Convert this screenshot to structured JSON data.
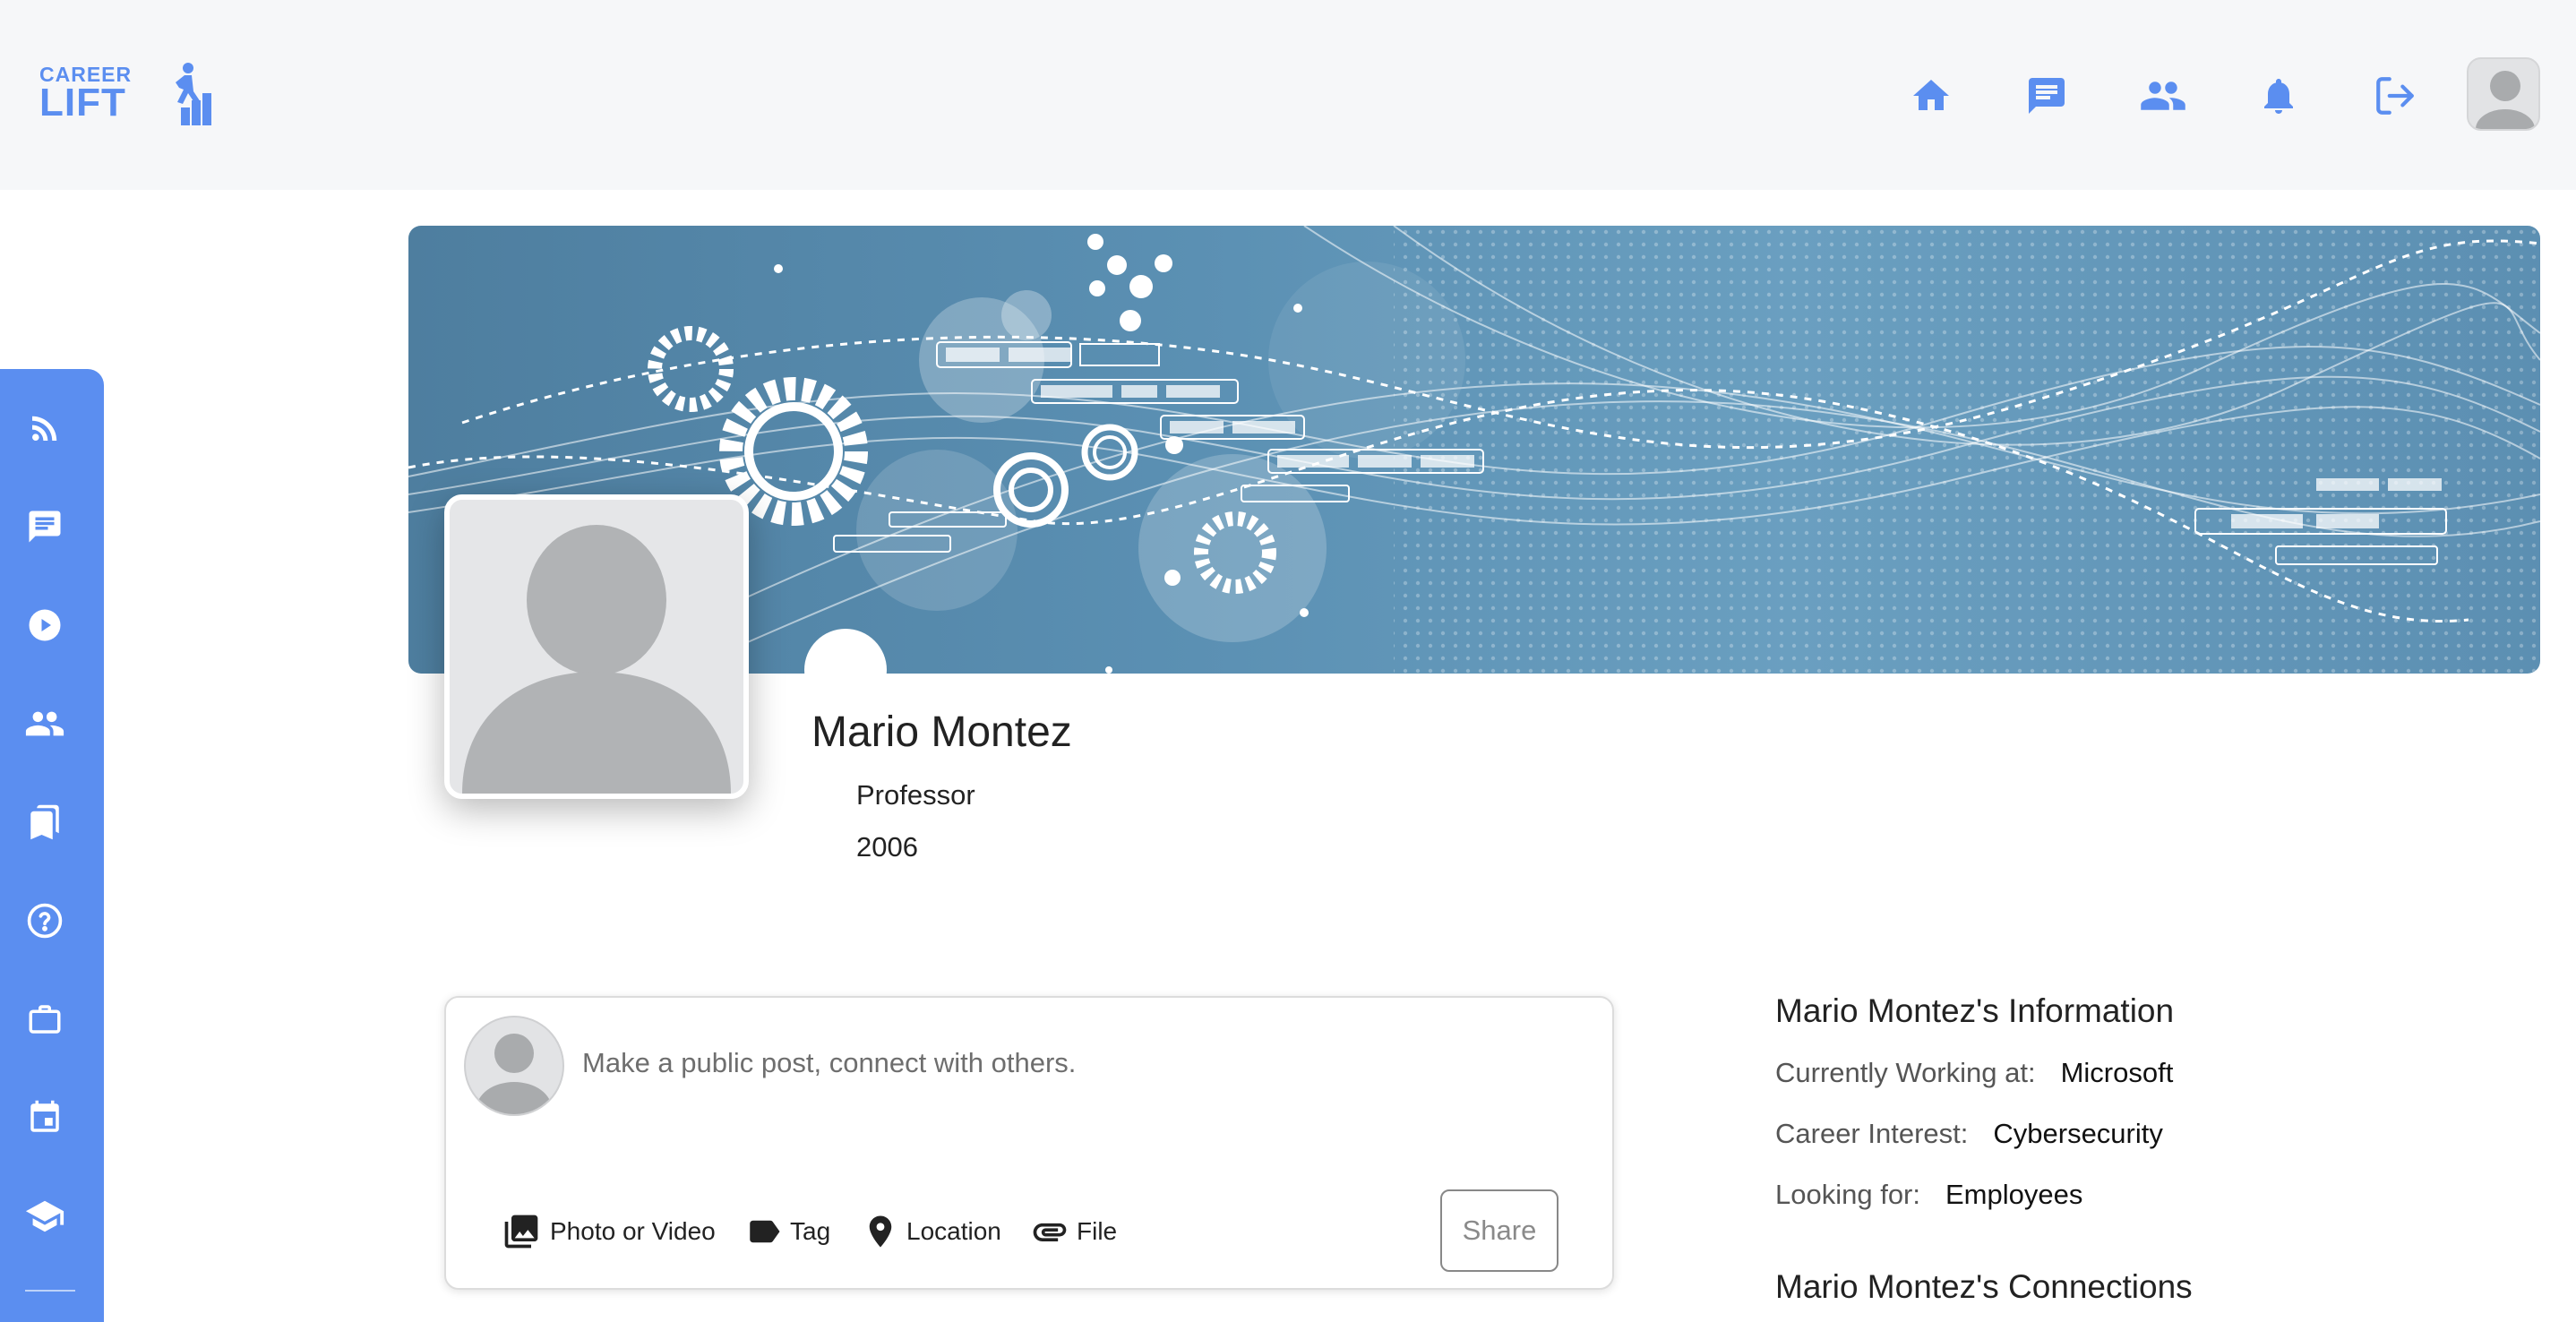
{
  "app": {
    "logo_top": "CAREER",
    "logo_bottom": "LIFT"
  },
  "topnav": {
    "items": [
      {
        "icon": "home-icon"
      },
      {
        "icon": "messages-icon"
      },
      {
        "icon": "connections-icon"
      },
      {
        "icon": "notifications-icon"
      },
      {
        "icon": "logout-icon"
      }
    ],
    "accent": "#5b8ef0"
  },
  "sidebar": {
    "color": "#5b8ef0",
    "items": [
      {
        "icon": "feed-icon"
      },
      {
        "icon": "chat-icon"
      },
      {
        "icon": "video-icon"
      },
      {
        "icon": "groups-icon"
      },
      {
        "icon": "bookmarks-icon"
      },
      {
        "icon": "help-icon"
      },
      {
        "icon": "jobs-icon"
      },
      {
        "icon": "events-icon"
      },
      {
        "icon": "education-icon"
      }
    ]
  },
  "profile": {
    "name": "Mario Montez",
    "title": "Professor",
    "year": "2006"
  },
  "composer": {
    "placeholder": "Make a public post, connect with others.",
    "actions": {
      "photo": "Photo or Video",
      "tag": "Tag",
      "location": "Location",
      "file": "File"
    },
    "share_label": "Share"
  },
  "info": {
    "title": "Mario Montez's Information",
    "working_label": "Currently Working at:",
    "working_value": "Microsoft",
    "interest_label": "Career Interest:",
    "interest_value": "Cybersecurity",
    "looking_label": "Looking for:",
    "looking_value": "Employees",
    "connections_title": "Mario Montez's Connections"
  }
}
